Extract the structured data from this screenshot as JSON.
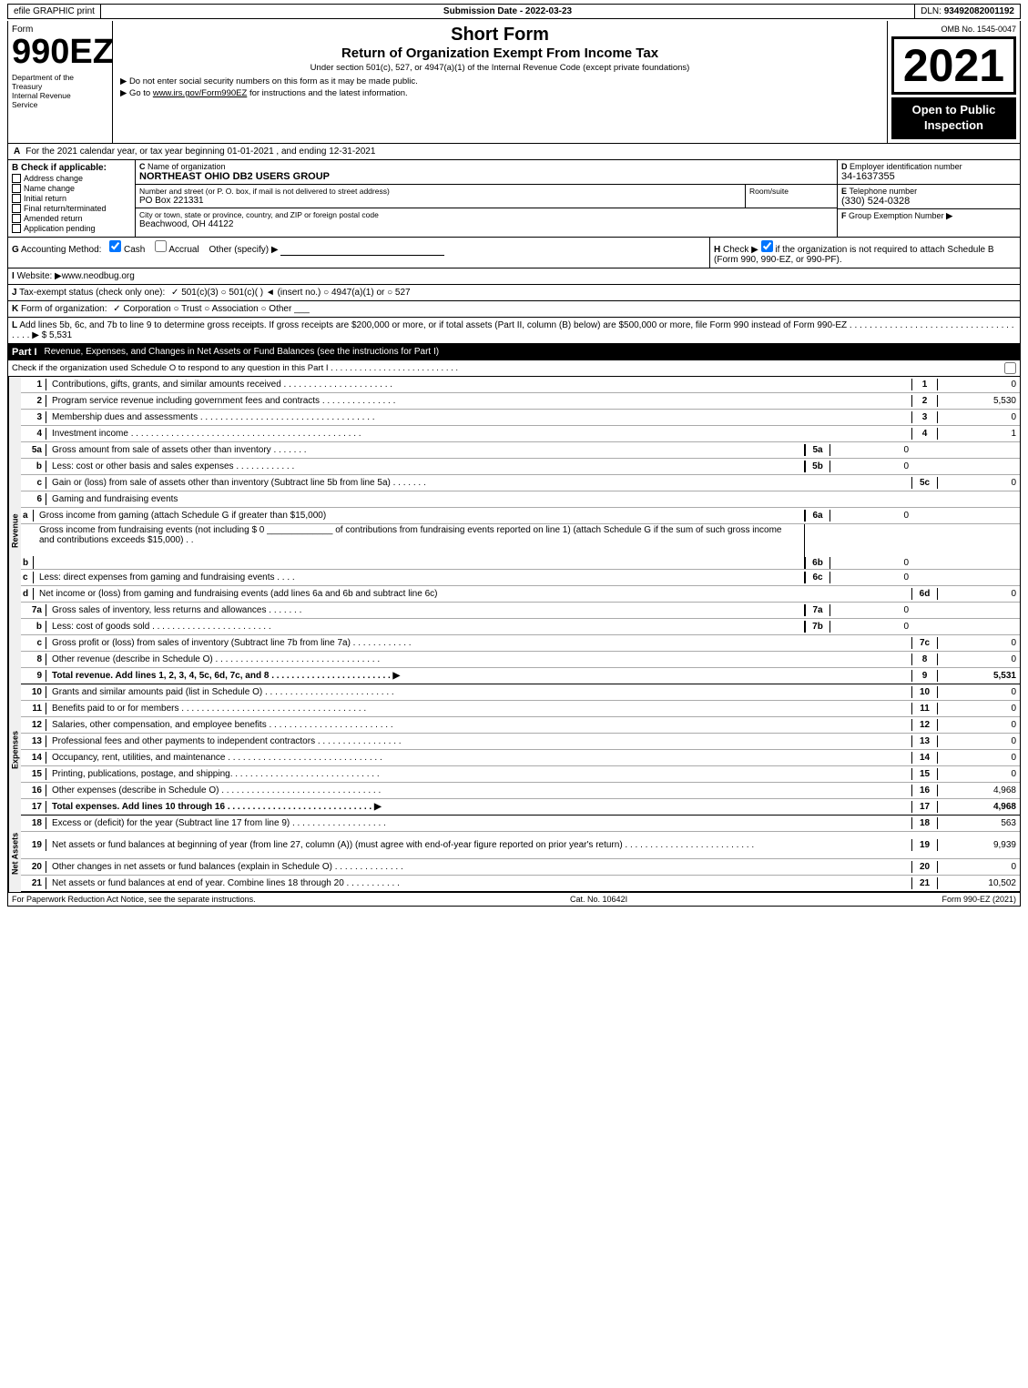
{
  "topBar": {
    "efile": "efile GRAPHIC print",
    "submissionLabel": "Submission Date - 2022-03-23",
    "dlnLabel": "DLN:",
    "dlnValue": "93492082001192"
  },
  "header": {
    "formLabel": "Form",
    "formNumber": "990EZ",
    "deptLine1": "Department of the",
    "deptLine2": "Treasury",
    "deptLine3": "Internal Revenue",
    "deptLine4": "Service",
    "shortForm": "Short Form",
    "returnTitle": "Return of Organization Exempt From Income Tax",
    "subtitle": "Under section 501(c), 527, or 4947(a)(1) of the Internal Revenue Code (except private foundations)",
    "instruction1": "▶ Do not enter social security numbers on this form as it may be made public.",
    "instruction2": "▶ Go to www.irs.gov/Form990EZ for instructions and the latest information.",
    "omb": "OMB No. 1545-0047",
    "year": "2021",
    "openToPublic": "Open to Public Inspection"
  },
  "sectionA": {
    "label": "A",
    "text": "For the 2021 calendar year, or tax year beginning 01-01-2021 , and ending 12-31-2021"
  },
  "sectionB": {
    "label": "B",
    "title": "Check if applicable:",
    "checkboxes": [
      {
        "id": "address-change",
        "label": "Address change",
        "checked": false
      },
      {
        "id": "name-change",
        "label": "Name change",
        "checked": false
      },
      {
        "id": "initial-return",
        "label": "Initial return",
        "checked": false
      },
      {
        "id": "final-return",
        "label": "Final return/terminated",
        "checked": false
      },
      {
        "id": "amended-return",
        "label": "Amended return",
        "checked": false
      },
      {
        "id": "application-pending",
        "label": "Application pending",
        "checked": false
      }
    ]
  },
  "sectionC": {
    "label": "C",
    "title": "Name of organization",
    "orgName": "NORTHEAST OHIO DB2 USERS GROUP"
  },
  "sectionD": {
    "label": "D",
    "title": "Employer identification number",
    "ein": "34-1637355"
  },
  "sectionE": {
    "label": "E",
    "title": "Telephone number",
    "phone": "(330) 524-0328"
  },
  "sectionF": {
    "label": "F",
    "title": "Group Exemption Number",
    "arrow": "▶"
  },
  "address": {
    "streetLabel": "Number and street (or P. O. box, if mail is not delivered to street address)",
    "roomLabel": "Room/suite",
    "street": "PO Box 221331",
    "cityLabel": "City or town, state or province, country, and ZIP or foreign postal code",
    "city": "Beachwood, OH  44122"
  },
  "sectionG": {
    "label": "G",
    "text": "Accounting Method:",
    "cashChecked": true,
    "cashLabel": "Cash",
    "accrualChecked": false,
    "accrualLabel": "Accrual",
    "otherLabel": "Other (specify) ▶",
    "line": "___________________________"
  },
  "sectionH": {
    "label": "H",
    "text": "Check ▶",
    "checkboxText": "if the organization is not required to attach Schedule B (Form 990, 990-EZ, or 990-PF)."
  },
  "sectionI": {
    "label": "I",
    "text": "Website: ▶www.neodbug.org"
  },
  "sectionJ": {
    "label": "J",
    "text": "Tax-exempt status (check only one):",
    "options": "✓ 501(c)(3)  ○ 501(c)(   ) ◄ (insert no.)  ○ 4947(a)(1) or  ○ 527"
  },
  "sectionK": {
    "label": "K",
    "text": "Form of organization:",
    "options": "✓ Corporation  ○ Trust  ○ Association  ○ Other ___"
  },
  "sectionL": {
    "label": "L",
    "text": "Add lines 5b, 6c, and 7b to line 9 to determine gross receipts. If gross receipts are $200,000 or more, or if total assets (Part II, column (B) below) are $500,000 or more, file Form 990 instead of Form 990-EZ . . . . . . . . . . . . . . . . . . . . . . . . . . . . . . . . . . . . . ▶ $ 5,531"
  },
  "partI": {
    "label": "Part I",
    "title": "Revenue, Expenses, and Changes in Net Assets or Fund Balances",
    "titleSub": "(see the instructions for Part I)",
    "checkText": "Check if the organization used Schedule O to respond to any question in this Part I . . . . . . . . . . . . . . . . . . . . . . . . . .",
    "rows": [
      {
        "num": "1",
        "desc": "Contributions, gifts, grants, and similar amounts received . . . . . . . . . . . . . . . . . . . . . .",
        "lineNum": "1",
        "val": "0"
      },
      {
        "num": "2",
        "desc": "Program service revenue including government fees and contracts . . . . . . . . . . . . . . .",
        "lineNum": "2",
        "val": "5,530"
      },
      {
        "num": "3",
        "desc": "Membership dues and assessments . . . . . . . . . . . . . . . . . . . . . . . . . . . . . . . . . . .",
        "lineNum": "3",
        "val": "0"
      },
      {
        "num": "4",
        "desc": "Investment income . . . . . . . . . . . . . . . . . . . . . . . . . . . . . . . . . . . . . . . . . . . . . .",
        "lineNum": "4",
        "val": "1"
      }
    ],
    "row5a": {
      "num": "5a",
      "desc": "Gross amount from sale of assets other than inventory . . . . . . .",
      "midLabel": "5a",
      "midVal": "0"
    },
    "row5b": {
      "num": "b",
      "desc": "Less: cost or other basis and sales expenses . . . . . . . . . . . .",
      "midLabel": "5b",
      "midVal": "0"
    },
    "row5c": {
      "num": "c",
      "desc": "Gain or (loss) from sale of assets other than inventory (Subtract line 5b from line 5a) . . . . . . .",
      "lineNum": "5c",
      "val": "0"
    },
    "row6": {
      "num": "6",
      "desc": "Gaming and fundraising events"
    },
    "row6a": {
      "num": "a",
      "desc": "Gross income from gaming (attach Schedule G if greater than $15,000)",
      "midLabel": "6a",
      "midVal": "0"
    },
    "row6b_desc": "Gross income from fundraising events (not including $ 0 _____________ of contributions from fundraising events reported on line 1) (attach Schedule G if the sum of such gross income and contributions exceeds $15,000)  .  .",
    "row6b": {
      "num": "b",
      "midLabel": "6b",
      "midVal": "0"
    },
    "row6c": {
      "num": "c",
      "desc": "Less: direct expenses from gaming and fundraising events  .  .  .  .",
      "midLabel": "6c",
      "midVal": "0"
    },
    "row6d": {
      "num": "d",
      "desc": "Net income or (loss) from gaming and fundraising events (add lines 6a and 6b and subtract line 6c)",
      "lineNum": "6d",
      "val": "0"
    },
    "row7a": {
      "num": "7a",
      "desc": "Gross sales of inventory, less returns and allowances . . . . . . .",
      "midLabel": "7a",
      "midVal": "0"
    },
    "row7b": {
      "num": "b",
      "desc": "Less: cost of goods sold  .  .  .  .  .  .  .  .  .  .  .  .  .  .  .  .  .  .  .  .  .  .  .  .",
      "midLabel": "7b",
      "midVal": "0"
    },
    "row7c": {
      "num": "c",
      "desc": "Gross profit or (loss) from sales of inventory (Subtract line 7b from line 7a) . . . . . . . . . . . .",
      "lineNum": "7c",
      "val": "0"
    },
    "row8": {
      "num": "8",
      "desc": "Other revenue (describe in Schedule O) . . . . . . . . . . . . . . . . . . . . . . . . . . . . . . . . .",
      "lineNum": "8",
      "val": "0"
    },
    "row9": {
      "num": "9",
      "desc": "Total revenue. Add lines 1, 2, 3, 4, 5c, 6d, 7c, and 8  . . . . . . . . . . . . . . . . . . . . . . . . ▶",
      "lineNum": "9",
      "val": "5,531",
      "bold": true
    }
  },
  "expenses": {
    "sideLabel": "Expenses",
    "rows": [
      {
        "num": "10",
        "desc": "Grants and similar amounts paid (list in Schedule O) . . . . . . . . . . . . . . . . . . . . . . . . . .",
        "lineNum": "10",
        "val": "0"
      },
      {
        "num": "11",
        "desc": "Benefits paid to or for members  . . . . . . . . . . . . . . . . . . . . . . . . . . . . . . . . . . . . .",
        "lineNum": "11",
        "val": "0"
      },
      {
        "num": "12",
        "desc": "Salaries, other compensation, and employee benefits . . . . . . . . . . . . . . . . . . . . . . . . .",
        "lineNum": "12",
        "val": "0"
      },
      {
        "num": "13",
        "desc": "Professional fees and other payments to independent contractors . . . . . . . . . . . . . . . . .",
        "lineNum": "13",
        "val": "0"
      },
      {
        "num": "14",
        "desc": "Occupancy, rent, utilities, and maintenance . . . . . . . . . . . . . . . . . . . . . . . . . . . . . . .",
        "lineNum": "14",
        "val": "0"
      },
      {
        "num": "15",
        "desc": "Printing, publications, postage, and shipping. . . . . . . . . . . . . . . . . . . . . . . . . . . . . .",
        "lineNum": "15",
        "val": "0"
      },
      {
        "num": "16",
        "desc": "Other expenses (describe in Schedule O) . . . . . . . . . . . . . . . . . . . . . . . . . . . . . . . .",
        "lineNum": "16",
        "val": "4,968"
      },
      {
        "num": "17",
        "desc": "Total expenses. Add lines 10 through 16  . . . . . . . . . . . . . . . . . . . . . . . . . . . . . ▶",
        "lineNum": "17",
        "val": "4,968",
        "bold": true
      }
    ]
  },
  "netAssets": {
    "sideLabel": "Net Assets",
    "rows": [
      {
        "num": "18",
        "desc": "Excess or (deficit) for the year (Subtract line 17 from line 9)  . . . . . . . . . . . . . . . . . . .",
        "lineNum": "18",
        "val": "563"
      },
      {
        "num": "19",
        "desc": "Net assets or fund balances at beginning of year (from line 27, column (A)) (must agree with end-of-year figure reported on prior year's return) . . . . . . . . . . . . . . . . . . . . . . . . . .",
        "lineNum": "19",
        "val": "9,939"
      },
      {
        "num": "20",
        "desc": "Other changes in net assets or fund balances (explain in Schedule O) . . . . . . . . . . . . . .",
        "lineNum": "20",
        "val": "0"
      },
      {
        "num": "21",
        "desc": "Net assets or fund balances at end of year. Combine lines 18 through 20 . . . . . . . . . . .",
        "lineNum": "21",
        "val": "10,502"
      }
    ]
  },
  "footer": {
    "paperworkText": "For Paperwork Reduction Act Notice, see the separate instructions.",
    "catNo": "Cat. No. 10642I",
    "formRef": "Form 990-EZ (2021)"
  }
}
